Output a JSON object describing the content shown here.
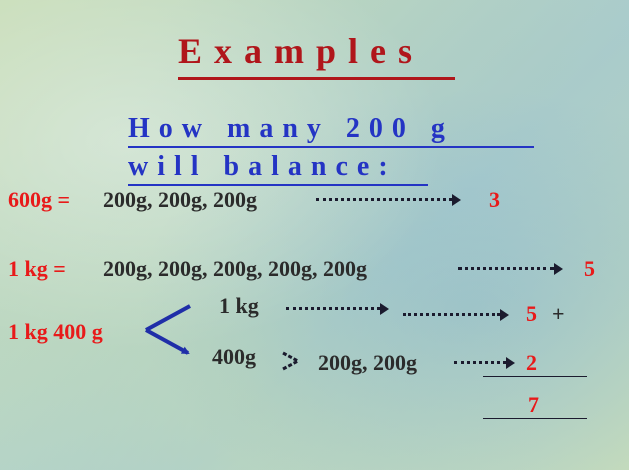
{
  "title": "Examples",
  "subtitle_line1": "How many 200 g",
  "subtitle_line2": "will balance:",
  "row1": {
    "lhs": "600g =",
    "items": "200g, 200g, 200g",
    "result": "3"
  },
  "row2": {
    "lhs": "1 kg =",
    "items": "200g, 200g, 200g, 200g, 200g",
    "result": "5"
  },
  "row3": {
    "lhs": "1 kg 400 g",
    "branch_top": "1 kg",
    "branch_top_result": "5",
    "plus": "+",
    "branch_bottom": "400g",
    "branch_bottom_items": "200g, 200g",
    "branch_bottom_result": "2",
    "total": "7"
  },
  "colors": {
    "title": "#b0161b",
    "subtitle": "#2434c4",
    "result": "#e81a1a"
  }
}
